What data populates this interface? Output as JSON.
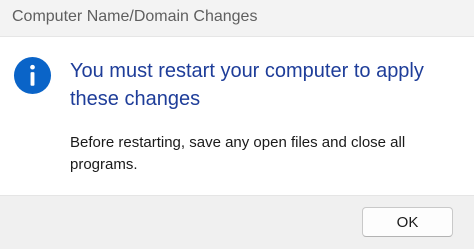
{
  "window": {
    "title": "Computer Name/Domain Changes"
  },
  "dialog": {
    "icon": "info-icon",
    "main_instruction": "You must restart your computer to apply these changes",
    "content": "Before restarting, save any open files and close all programs."
  },
  "buttons": {
    "ok_label": "OK"
  },
  "colors": {
    "icon_blue": "#0a64c8",
    "instruction_blue": "#1e3d99"
  }
}
